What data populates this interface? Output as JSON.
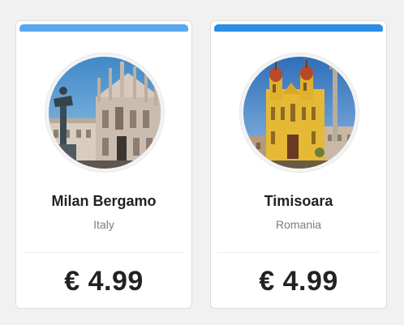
{
  "cards": [
    {
      "city": "Milan Bergamo",
      "country": "Italy",
      "price": "€ 4.99",
      "accent_color": "#5aa7ef",
      "image": "milan-cathedral-photo"
    },
    {
      "city": "Timisoara",
      "country": "Romania",
      "price": "€ 4.99",
      "accent_color": "#2b8de6",
      "image": "timisoara-cathedral-photo"
    }
  ]
}
